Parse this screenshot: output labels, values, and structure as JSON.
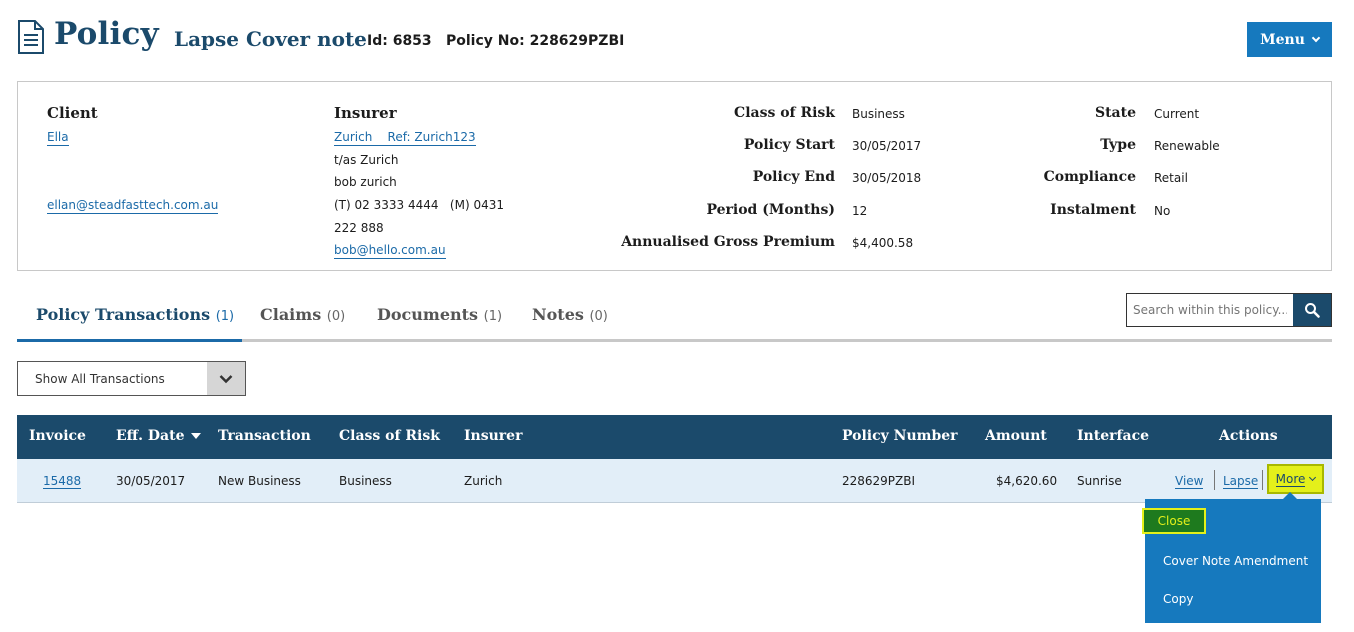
{
  "header": {
    "title": "Policy",
    "subtitle": "Lapse Cover note",
    "id_text": "Id: 6853",
    "policy_no_text": "Policy No: 228629PZBI",
    "menu_label": "Menu"
  },
  "client": {
    "heading": "Client",
    "name": "Ella",
    "email": "ellan@steadfasttech.com.au"
  },
  "insurer": {
    "heading": "Insurer",
    "name_ref": "Zurich    Ref: Zurich123",
    "trading_as": "t/as Zurich",
    "contact": "bob zurich",
    "phone_line1": "(T) 02 3333 4444   (M) 0431",
    "phone_line2": "222 888",
    "email": "bob@hello.com.au"
  },
  "policy_details": [
    {
      "label": "Class of Risk",
      "value": "Business"
    },
    {
      "label": "Policy Start",
      "value": "30/05/2017"
    },
    {
      "label": "Policy End",
      "value": "30/05/2018"
    },
    {
      "label": "Period (Months)",
      "value": "12"
    },
    {
      "label": "Annualised Gross Premium",
      "value": "$4,400.58"
    }
  ],
  "status_details": [
    {
      "label": "State",
      "value": "Current"
    },
    {
      "label": "Type",
      "value": "Renewable"
    },
    {
      "label": "Compliance",
      "value": "Retail"
    },
    {
      "label": "Instalment",
      "value": "No"
    }
  ],
  "tabs": [
    {
      "label": "Policy Transactions",
      "count": "(1)"
    },
    {
      "label": "Claims",
      "count": "(0)"
    },
    {
      "label": "Documents",
      "count": "(1)"
    },
    {
      "label": "Notes",
      "count": "(0)"
    }
  ],
  "search": {
    "placeholder": "Search within this policy..."
  },
  "filter": {
    "selected": "Show All Transactions"
  },
  "table": {
    "headers": [
      "Invoice",
      "Eff. Date",
      "Transaction",
      "Class of Risk",
      "Insurer",
      "Policy Number",
      "Amount",
      "Interface",
      "Actions"
    ],
    "rows": [
      {
        "invoice": "15488",
        "eff_date": "30/05/2017",
        "transaction": "New Business",
        "class_of_risk": "Business",
        "insurer": "Zurich",
        "policy_number": "228629PZBI",
        "amount": "$4,620.60",
        "interface": "Sunrise",
        "actions": {
          "view": "View",
          "lapse": "Lapse",
          "more": "More"
        }
      }
    ]
  },
  "more_menu": {
    "items": [
      "Close",
      "Cover Note Amendment",
      "Copy"
    ]
  },
  "colors": {
    "primary_dark": "#1b4a6b",
    "accent_blue": "#1679be",
    "link": "#1b6aa8",
    "highlight": "#e4f01a",
    "close_green": "#1e7a1e"
  }
}
